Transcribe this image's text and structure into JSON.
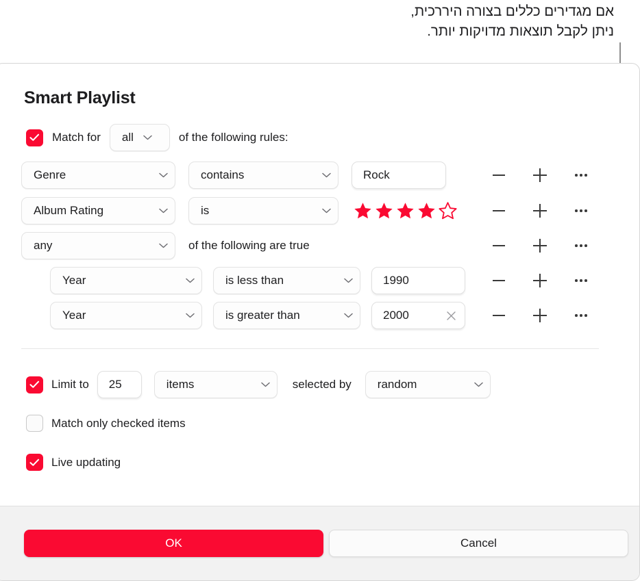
{
  "annotation": {
    "text": "אם מגדירים כללים בצורה היררכית,\nניתן לקבל תוצאות מדויקות יותר.",
    "line_color": "#8e8e8e"
  },
  "dialog": {
    "title": "Smart Playlist",
    "accent_color": "#fa0a32",
    "match": {
      "checkbox_checked": true,
      "prefix_label": "Match  for",
      "scope_value": "all",
      "suffix_label": "of the following rules:"
    },
    "rules": [
      {
        "field": "Genre",
        "operator": "contains",
        "value": "Rock",
        "value_kind": "text",
        "nested": false
      },
      {
        "field": "Album Rating",
        "operator": "is",
        "value_kind": "stars",
        "stars_filled": 4,
        "stars_total": 5,
        "nested": false
      },
      {
        "field": "any",
        "group_label": "of the following are true",
        "value_kind": "group",
        "nested": false
      },
      {
        "field": "Year",
        "operator": "is less than",
        "value": "1990",
        "value_kind": "text",
        "nested": true
      },
      {
        "field": "Year",
        "operator": "is greater than",
        "value": "2000",
        "value_kind": "text",
        "clearable": true,
        "nested": true
      }
    ],
    "row_actions": {
      "remove": "remove-rule",
      "add": "add-rule",
      "more": "more-options"
    },
    "options": {
      "limit": {
        "checked": true,
        "label": "Limit to",
        "amount": "25",
        "unit": "items",
        "selected_by_label": "selected by",
        "selected_by": "random"
      },
      "match_only_checked": {
        "checked": false,
        "label": "Match only checked items"
      },
      "live_updating": {
        "checked": true,
        "label": "Live updating"
      }
    },
    "footer": {
      "ok_label": "OK",
      "cancel_label": "Cancel"
    }
  }
}
